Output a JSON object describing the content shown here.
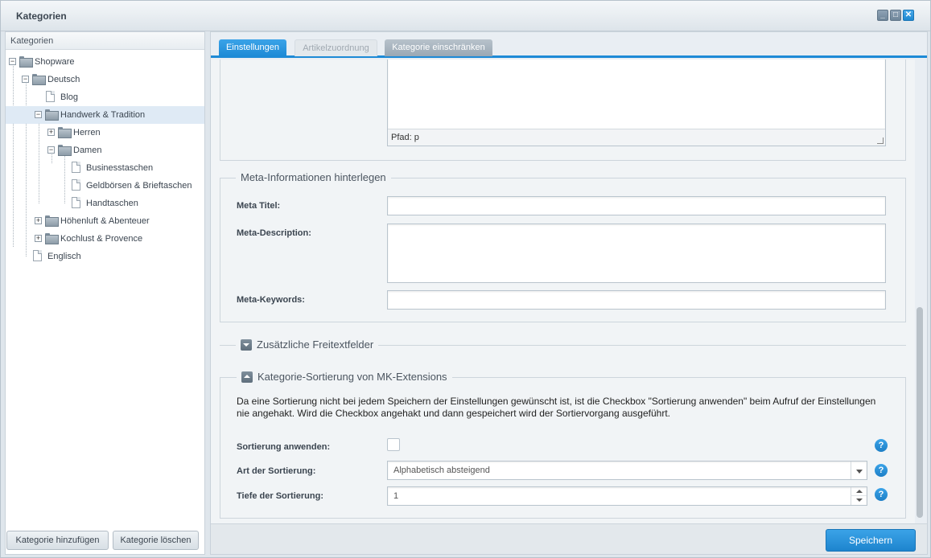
{
  "window": {
    "title": "Kategorien"
  },
  "sidebar": {
    "header": "Kategorien",
    "tree": [
      {
        "label": "Shopware",
        "type": "folder",
        "expanded": true
      },
      {
        "label": "Deutsch",
        "type": "folder",
        "expanded": true
      },
      {
        "label": "Blog",
        "type": "leaf"
      },
      {
        "label": "Handwerk & Tradition",
        "type": "folder",
        "expanded": true,
        "selected": true
      },
      {
        "label": "Herren",
        "type": "folder",
        "expanded": false
      },
      {
        "label": "Damen",
        "type": "folder",
        "expanded": true
      },
      {
        "label": "Businesstaschen",
        "type": "leaf"
      },
      {
        "label": "Geldbörsen & Brieftaschen",
        "type": "leaf"
      },
      {
        "label": "Handtaschen",
        "type": "leaf"
      },
      {
        "label": "Höhenluft & Abenteuer",
        "type": "folder",
        "expanded": false
      },
      {
        "label": "Kochlust & Provence",
        "type": "folder",
        "expanded": false
      },
      {
        "label": "Englisch",
        "type": "leaf"
      }
    ],
    "add_button": "Kategorie hinzufügen",
    "delete_button": "Kategorie löschen"
  },
  "tabs": [
    {
      "label": "Einstellungen",
      "state": "active"
    },
    {
      "label": "Artikelzuordnung",
      "state": "disabled"
    },
    {
      "label": "Kategorie einschränken",
      "state": "normal"
    }
  ],
  "editor": {
    "path_status": "Pfad: p"
  },
  "meta": {
    "legend": "Meta-Informationen hinterlegen",
    "title_label": "Meta Titel:",
    "title_value": "",
    "description_label": "Meta-Description:",
    "description_value": "",
    "keywords_label": "Meta-Keywords:",
    "keywords_value": ""
  },
  "freetext": {
    "legend": "Zusätzliche Freitextfelder"
  },
  "sorting": {
    "legend": "Kategorie-Sortierung von MK-Extensions",
    "description": "Da eine Sortierung nicht bei jedem Speichern der Einstellungen gewünscht ist, ist die Checkbox \"Sortierung anwenden\" beim Aufruf der Einstellungen nie angehakt. Wird die Checkbox angehakt und dann gespeichert wird der Sortiervorgang ausgeführt.",
    "apply_label": "Sortierung anwenden:",
    "apply_checked": false,
    "type_label": "Art der Sortierung:",
    "type_value": "Alphabetisch absteigend",
    "depth_label": "Tiefe der Sortierung:",
    "depth_value": "1",
    "help_glyph": "?"
  },
  "footer": {
    "save_button": "Speichern"
  },
  "colors": {
    "accent": "#1d8ad6",
    "selected_row": "#dfeaf5"
  }
}
